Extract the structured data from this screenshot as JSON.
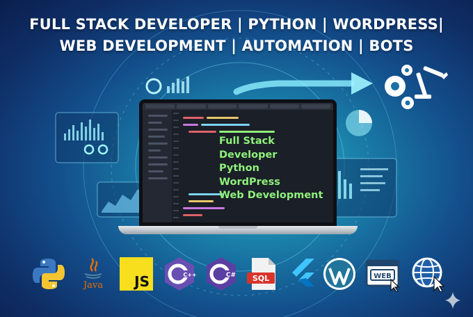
{
  "headline": {
    "line1": "FULL STACK DEVELOPER | PYTHON | WORDPRESS|",
    "line2": "WEB DEVELOPMENT | AUTOMATION | BOTS"
  },
  "screen": {
    "line1": "Full Stack Developer",
    "line2": "Python",
    "line3": "WordPress",
    "line4": "Web Development"
  },
  "icons": {
    "java_label": "Java",
    "js_label": "JS",
    "cpp_label": "C++",
    "csharp_label": "C#",
    "sql_label": "SQL",
    "web_label": "WEB",
    "names": [
      "python-icon",
      "java-icon",
      "javascript-icon",
      "cpp-icon",
      "csharp-icon",
      "sql-file-icon",
      "flutter-icon",
      "wordpress-icon",
      "web-browser-icon",
      "globe-cursor-icon"
    ]
  },
  "colors": {
    "screen_text": "#8ff27c",
    "js_yellow": "#f7df1e",
    "cpp_purple": "#6a4fb3",
    "csharp_purple": "#5b3fa3",
    "sql_red": "#d9342b",
    "wordpress_blue": "#21759b",
    "flutter_blue": "#40c4ff"
  }
}
